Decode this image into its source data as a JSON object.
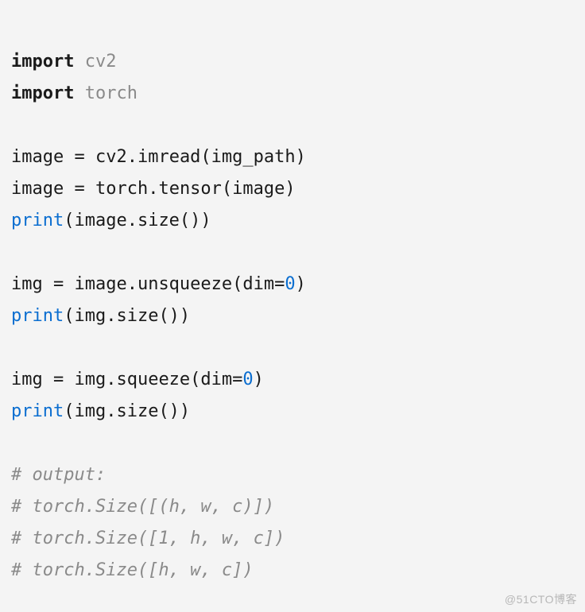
{
  "code": {
    "l1": {
      "kw": "import",
      "mod": "cv2"
    },
    "l2": {
      "kw": "import",
      "mod": "torch"
    },
    "l3": {
      "txt": "image ",
      "op": "=",
      "rest": " cv2.imread(img_path)"
    },
    "l4": {
      "txt": "image ",
      "op": "=",
      "rest": " torch.tensor(image)"
    },
    "l5": {
      "func": "print",
      "rest": "(image.size())"
    },
    "l6": {
      "txt": "img ",
      "op": "=",
      "rest1": " image.unsqueeze(dim",
      "assign": "=",
      "num": "0",
      "rest2": ")"
    },
    "l7": {
      "func": "print",
      "rest": "(img.size())"
    },
    "l8": {
      "txt": "img ",
      "op": "=",
      "rest1": " img.squeeze(dim",
      "assign": "=",
      "num": "0",
      "rest2": ")"
    },
    "l9": {
      "func": "print",
      "rest": "(img.size())"
    },
    "c1": "# output:",
    "c2": "# torch.Size([(h, w, c)])",
    "c3": "# torch.Size([1, h, w, c])",
    "c4": "# torch.Size([h, w, c])"
  },
  "watermark": "@51CTO博客"
}
